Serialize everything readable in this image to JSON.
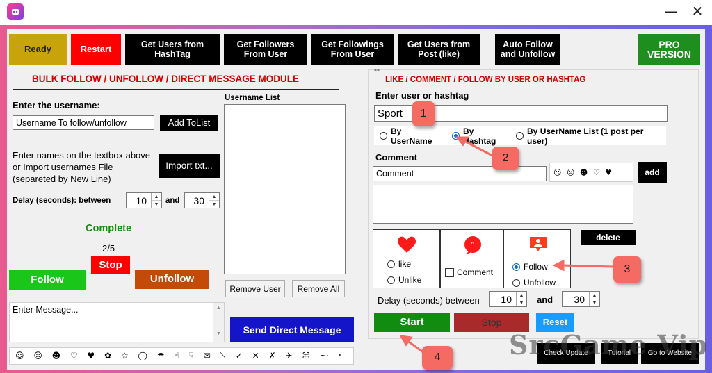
{
  "toolbar": {
    "ready": "Ready",
    "restart": "Restart",
    "get_users_hashtag": "Get Users from HashTag",
    "get_followers": "Get Followers From User",
    "get_followings": "Get Followings From User",
    "get_users_post": "Get Users from Post (like)",
    "auto_follow": "Auto Follow and Unfollow",
    "pro_version": "PRO VERSION"
  },
  "left": {
    "module_title": "BULK FOLLOW / UNFOLLOW / DIRECT MESSAGE MODULE",
    "enter_username_label": "Enter the username:",
    "username_input": "Username To follow/unfollow",
    "add_to_list": "Add ToList",
    "import_hint": "Enter names on the textbox above or Import usernames File (separeted by New Line)",
    "import_button": "Import txt...",
    "delay_label": "Delay (seconds): between",
    "delay_from": "10",
    "delay_and": "and",
    "delay_to": "30",
    "status": "Complete",
    "progress": "2/5",
    "stop": "Stop",
    "follow": "Follow",
    "unfollow": "Unfollow",
    "message_placeholder": "Enter Message...",
    "username_list_label": "Username List",
    "remove_user": "Remove User",
    "remove_all": "Remove All",
    "send_dm": "Send Direct Message",
    "emoji_bar": "☺ ☹ ☻ ♡ ♥ ✿ ☆ ◯ ☂ ☝ ☟ ✉ ⟍ ✓ ✕ ✗ ✈ ⌘ ⁓ ⁌"
  },
  "right": {
    "dash": "--",
    "section_title": "LIKE / COMMENT / FOLLOW BY USER OR HASHTAG",
    "enter_user_label": "Enter user or hashtag",
    "user_input": "Sport",
    "radio_username": "By UserName",
    "radio_hashtag": "By Hashtag",
    "radio_list": "By UserName List (1 post per user)",
    "comment_label": "Comment",
    "comment_input": "Comment",
    "emoji_small": "☺ ☹ ☻ ♡ ♥",
    "add": "add",
    "delete": "delete",
    "like": "like",
    "unlike": "Unlike",
    "comment_check": "Comment",
    "follow": "Follow",
    "unfollow": "Unfollow",
    "delay_label": "Delay (seconds) between",
    "delay_from": "10",
    "delay_and": "and",
    "delay_to": "30",
    "start": "Start",
    "stop": "Stop",
    "reset": "Reset",
    "bottom_btn1": "Check Update",
    "bottom_btn2": "Tutorial",
    "bottom_btn3": "Go to Website"
  },
  "callouts": [
    "1",
    "2",
    "3",
    "4"
  ],
  "watermark": "SrcGame.Vip",
  "colors": {
    "ready": "#c8a40a",
    "restart": "#ff0000",
    "pro": "#1e8f1e",
    "follow": "#19c619",
    "unfollow": "#c44a08",
    "send": "#1414c8",
    "start": "#118c11",
    "stop_right": "#a82a2a",
    "reset": "#1a9cff",
    "status": "#1b8a1b",
    "title_red": "#d40000"
  }
}
